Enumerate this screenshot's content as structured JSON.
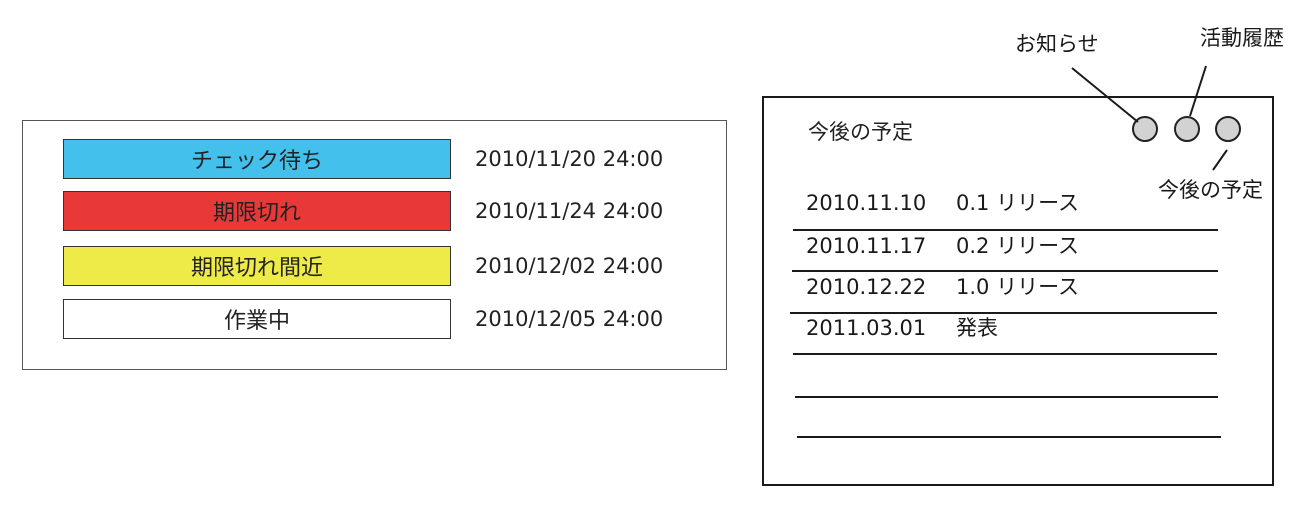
{
  "status_list": [
    {
      "label": "チェック待ち",
      "date": "2010/11/20 24:00",
      "color": "#44c0ec"
    },
    {
      "label": "期限切れ",
      "date": "2010/11/24 24:00",
      "color": "#e93838"
    },
    {
      "label": "期限切れ間近",
      "date": "2010/12/02 24:00",
      "color": "#eeea48"
    },
    {
      "label": "作業中",
      "date": "2010/12/05 24:00",
      "color": "#ffffff"
    }
  ],
  "schedule_widget": {
    "title": "今後の予定",
    "tabs": [
      {
        "callout": "お知らせ"
      },
      {
        "callout": "活動履歴"
      },
      {
        "callout": "今後の予定"
      }
    ],
    "entries": [
      {
        "date": "2010.11.10",
        "text": "0.1 リリース"
      },
      {
        "date": "2010.11.17",
        "text": "0.2 リリース"
      },
      {
        "date": "2010.12.22",
        "text": "1.0 リリース"
      },
      {
        "date": "2011.03.01",
        "text": "発表"
      }
    ]
  }
}
